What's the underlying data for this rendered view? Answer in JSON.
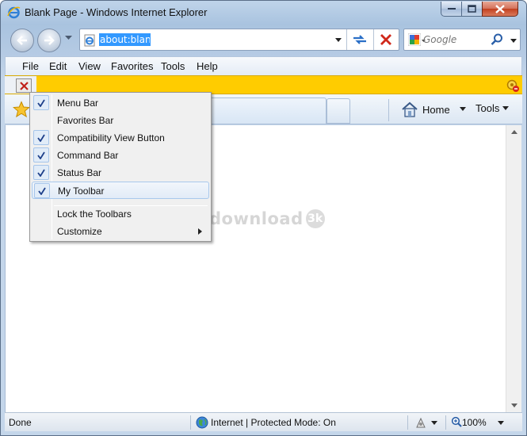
{
  "window": {
    "title": "Blank Page - Windows Internet Explorer"
  },
  "navigation": {
    "address_value": "about:blank",
    "search_placeholder": "Google"
  },
  "menubar": {
    "items": [
      "File",
      "Edit",
      "View",
      "Favorites",
      "Tools",
      "Help"
    ]
  },
  "command_bar": {
    "home_label": "Home",
    "tools_label": "Tools"
  },
  "context_menu": {
    "items": [
      {
        "label": "Menu Bar",
        "checked": true
      },
      {
        "label": "Favorites Bar",
        "checked": false
      },
      {
        "label": "Compatibility View Button",
        "checked": true
      },
      {
        "label": "Command Bar",
        "checked": true
      },
      {
        "label": "Status Bar",
        "checked": true
      },
      {
        "label": "My Toolbar",
        "checked": true,
        "highlighted": true
      }
    ],
    "extra_items": [
      {
        "label": "Lock the Toolbars"
      },
      {
        "label": "Customize",
        "has_submenu": true
      }
    ]
  },
  "watermark": {
    "text": "download",
    "badge": "3k"
  },
  "statusbar": {
    "status_text": "Done",
    "zone_text": "Internet | Protected Mode: On",
    "zoom_text": "100%"
  },
  "colors": {
    "infobar": "#ffcc00",
    "selection": "#3399ff",
    "stop_red": "#d0281a",
    "refresh_blue": "#2a6fc7"
  }
}
